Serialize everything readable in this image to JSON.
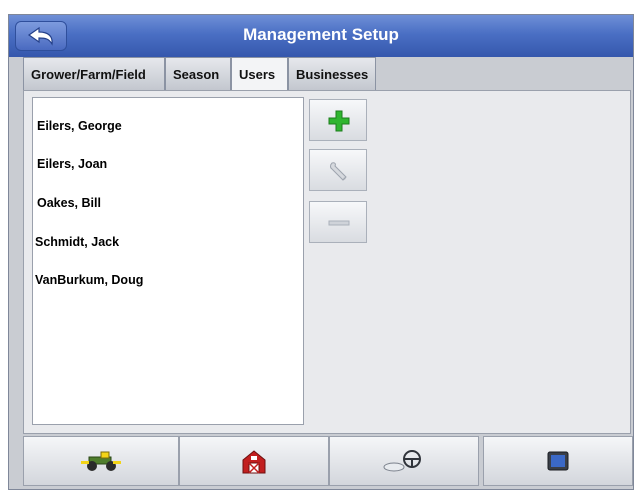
{
  "window": {
    "title": "Management Setup"
  },
  "tabs": [
    {
      "label": "Grower/Farm/Field",
      "active": false
    },
    {
      "label": "Season",
      "active": false
    },
    {
      "label": "Users",
      "active": true
    },
    {
      "label": "Businesses",
      "active": false
    }
  ],
  "users": [
    "Eilers, George",
    "Eilers, Joan",
    "Oakes, Bill",
    "Schmidt, Jack",
    "VanBurkum, Doug"
  ],
  "side_buttons": [
    {
      "icon": "add-icon",
      "enabled": true
    },
    {
      "icon": "wrench-icon",
      "enabled": false
    },
    {
      "icon": "minus-icon",
      "enabled": false
    }
  ],
  "bottom_buttons": [
    {
      "icon": "tractor-icon"
    },
    {
      "icon": "barn-icon"
    },
    {
      "icon": "steering-wheel-icon"
    },
    {
      "icon": "display-icon"
    }
  ],
  "colors": {
    "titlebar": "#4a6fc4",
    "add_green": "#2fb52f"
  }
}
